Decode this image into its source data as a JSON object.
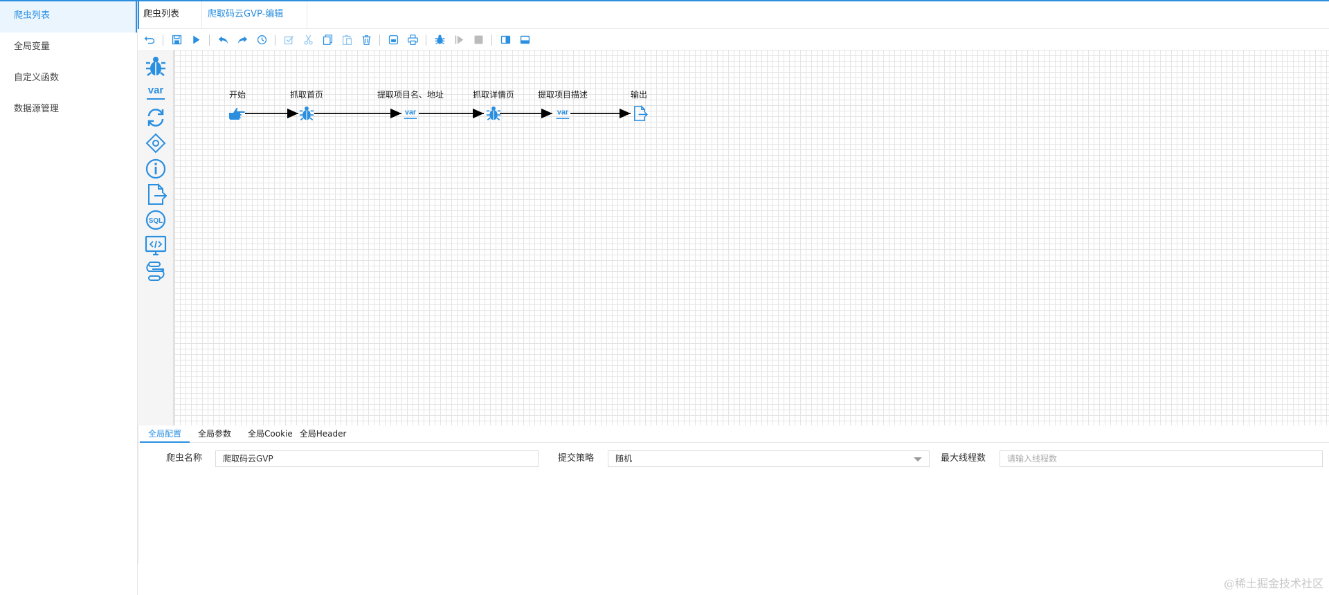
{
  "sidebar": {
    "items": [
      {
        "label": "爬虫列表",
        "active": true
      },
      {
        "label": "全局变量"
      },
      {
        "label": "自定义函数"
      },
      {
        "label": "数据源管理"
      }
    ]
  },
  "tabs": [
    {
      "label": "爬虫列表"
    },
    {
      "label": "爬取码云GVP-编辑"
    }
  ],
  "toolbar": {
    "icons": [
      "undo-icon",
      "save-icon",
      "run-icon",
      "back-icon",
      "forward-icon",
      "history-icon",
      "select-icon",
      "cut-icon",
      "copy-icon",
      "paste-icon",
      "delete-icon",
      "export-icon",
      "print-icon",
      "debug-icon",
      "step-icon",
      "stop-icon",
      "split-left-icon",
      "split-bottom-icon"
    ]
  },
  "palette": {
    "items": [
      "spider-icon",
      "var-icon",
      "loop-icon",
      "condition-icon",
      "info-icon",
      "output-icon",
      "sql-icon",
      "code-icon",
      "subprocess-icon"
    ]
  },
  "flow": {
    "nodes": [
      {
        "label": "开始",
        "icon": "start-hand-icon"
      },
      {
        "label": "抓取首页",
        "icon": "spider-icon"
      },
      {
        "label": "提取项目名、地址",
        "icon": "var-icon"
      },
      {
        "label": "抓取详情页",
        "icon": "spider-icon"
      },
      {
        "label": "提取项目描述",
        "icon": "var-icon"
      },
      {
        "label": "输出",
        "icon": "output-icon"
      }
    ]
  },
  "bottom": {
    "tabs": [
      {
        "label": "全局配置",
        "active": true
      },
      {
        "label": "全局参数"
      },
      {
        "label": "全局Cookie"
      },
      {
        "label": "全局Header"
      }
    ],
    "form": {
      "name_label": "爬虫名称",
      "name_value": "爬取码云GVP",
      "strategy_label": "提交策略",
      "strategy_value": "随机",
      "threads_label": "最大线程数",
      "threads_placeholder": "请输入线程数"
    }
  },
  "watermark": "@稀土掘金技术社区",
  "colors": {
    "accent": "#2b8fe0"
  }
}
